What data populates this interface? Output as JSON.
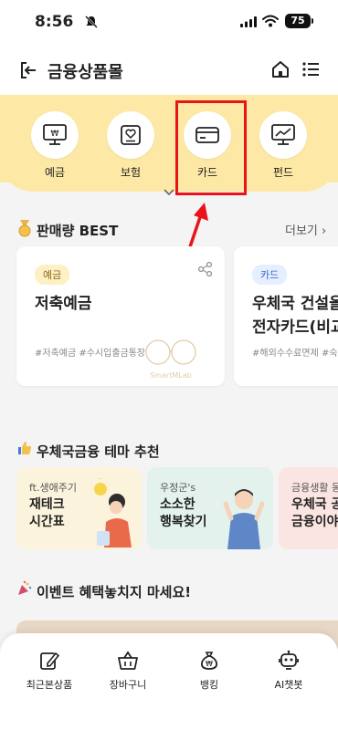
{
  "status_bar": {
    "time": "8:56",
    "battery": "75"
  },
  "header": {
    "title": "금융상품몰"
  },
  "categories": [
    {
      "label": "예금",
      "icon": "deposit-monitor-icon"
    },
    {
      "label": "보험",
      "icon": "insurance-heart-icon"
    },
    {
      "label": "카드",
      "icon": "card-icon"
    },
    {
      "label": "펀드",
      "icon": "fund-chart-icon"
    }
  ],
  "best": {
    "title": "판매량 BEST",
    "more": "더보기",
    "cards": [
      {
        "badge": "예금",
        "name": "저축예금",
        "tags": "#저축예금 #수시입출금통장"
      },
      {
        "badge": "카드",
        "name_line1": "우체국 건설올",
        "name_line2": "전자카드(비교",
        "tags": "#해외수수료면제 #숙박"
      }
    ],
    "watermark": "SmartMLab"
  },
  "theme": {
    "title": "우체국금융 테마 추천",
    "cards": [
      {
        "small": "ft.생애주기",
        "line1": "재테크",
        "line2": "시간표"
      },
      {
        "small": "우정군's",
        "line1": "소소한",
        "line2": "행복찾기"
      },
      {
        "small": "금융생활 동",
        "line1": "우체국 공",
        "line2": "금융이야"
      }
    ]
  },
  "event": {
    "title": "이벤트 혜택놓치지 마세요!"
  },
  "bottom_nav": [
    {
      "label": "최근본상품",
      "icon": "edit-note-icon"
    },
    {
      "label": "장바구니",
      "icon": "basket-icon"
    },
    {
      "label": "뱅킹",
      "icon": "money-bag-icon"
    },
    {
      "label": "AI챗봇",
      "icon": "robot-icon"
    }
  ],
  "colors": {
    "band": "#fde9a5",
    "highlight": "#e8141a",
    "deposit_badge": "#fdf0c4",
    "card_badge": "#e6efff"
  }
}
